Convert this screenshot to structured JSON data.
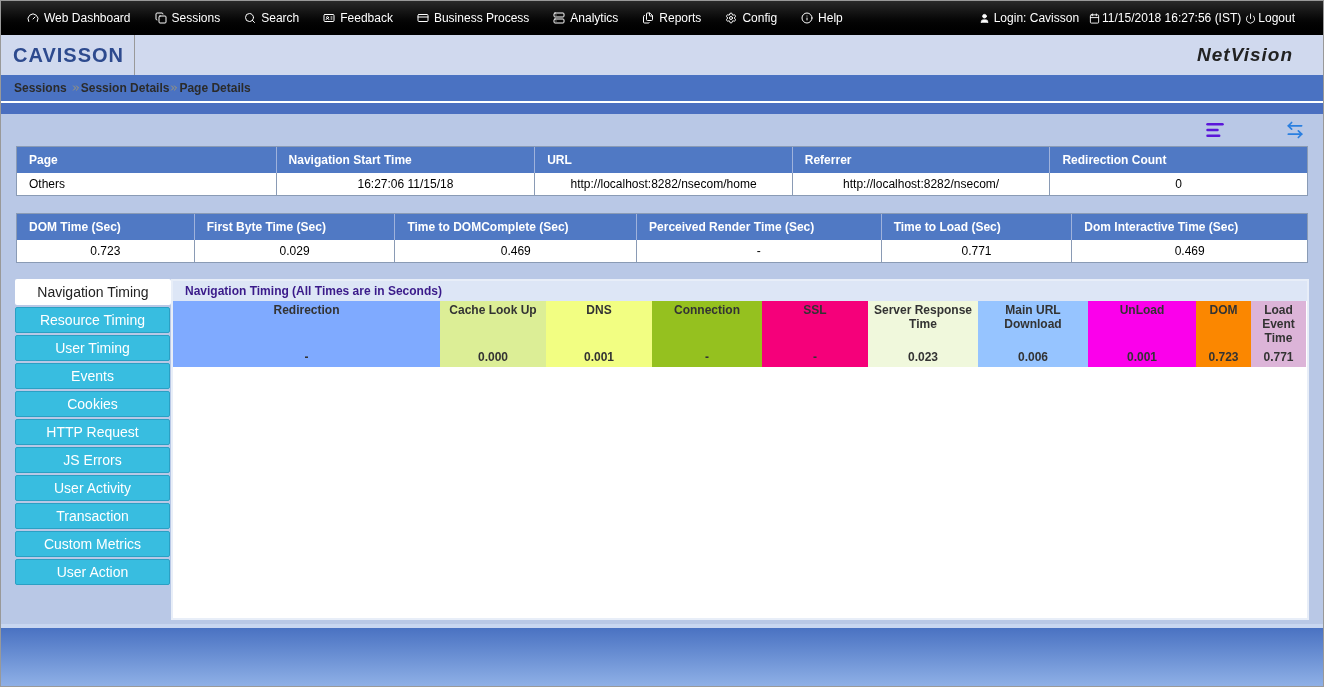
{
  "menu": [
    "Web Dashboard",
    "Sessions",
    "Search",
    "Feedback",
    "Business Process",
    "Analytics",
    "Reports",
    "Config",
    "Help"
  ],
  "user": {
    "login": "Login: Cavisson",
    "datetime": "11/15/2018 16:27:56 (IST)",
    "logout": "Logout"
  },
  "brand": {
    "logo": "CAVISSON",
    "product": "NetVision"
  },
  "breadcrumb": [
    "Sessions",
    "Session Details",
    "Page Details"
  ],
  "page_table": {
    "columns": [
      "Page",
      "Navigation Start Time",
      "URL",
      "Referrer",
      "Redirection Count"
    ],
    "row": [
      "Others",
      "16:27:06 11/15/18",
      "http://localhost:8282/nsecom/home",
      "http://localhost:8282/nsecom/",
      "0"
    ]
  },
  "time_table": {
    "columns": [
      "DOM Time (Sec)",
      "First Byte Time (Sec)",
      "Time to DOMComplete (Sec)",
      "Perceived Render Time (Sec)",
      "Time to Load (Sec)",
      "Dom Interactive Time (Sec)"
    ],
    "row": [
      "0.723",
      "0.029",
      "0.469",
      "-",
      "0.771",
      "0.469"
    ]
  },
  "side_tabs": [
    {
      "label": "Navigation Timing",
      "selected": true
    },
    {
      "label": "Resource Timing",
      "selected": false
    },
    {
      "label": "User Timing",
      "selected": false
    },
    {
      "label": "Events",
      "selected": false
    },
    {
      "label": "Cookies",
      "selected": false
    },
    {
      "label": "HTTP Request",
      "selected": false
    },
    {
      "label": "JS Errors",
      "selected": false
    },
    {
      "label": "User Activity",
      "selected": false
    },
    {
      "label": "Transaction",
      "selected": false
    },
    {
      "label": "Custom Metrics",
      "selected": false
    },
    {
      "label": "User Action",
      "selected": false
    }
  ],
  "timing": {
    "title": "Navigation Timing (All Times are in Seconds)",
    "segments": [
      {
        "label": "Redirection",
        "value": "-",
        "color": "#7faaff"
      },
      {
        "label": "Cache Look Up",
        "value": "0.000",
        "color": "#dcee96"
      },
      {
        "label": "DNS",
        "value": "0.001",
        "color": "#f2fe82"
      },
      {
        "label": "Connection",
        "value": "-",
        "color": "#95c11f"
      },
      {
        "label": "SSL",
        "value": "-",
        "color": "#f5007a"
      },
      {
        "label": "Server Response Time",
        "value": "0.023",
        "color": "#f0f8dc"
      },
      {
        "label": "Main URL Download",
        "value": "0.006",
        "color": "#96c4ff"
      },
      {
        "label": "UnLoad",
        "value": "0.001",
        "color": "#fb00eb"
      },
      {
        "label": "DOM",
        "value": "0.723",
        "color": "#fb8700"
      },
      {
        "label": "Load Event Time",
        "value": "0.771",
        "color": "#dcb4d8"
      }
    ]
  }
}
